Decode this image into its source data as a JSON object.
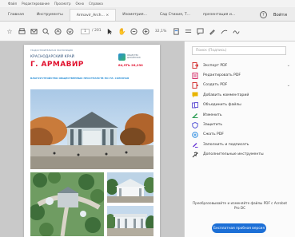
{
  "menubar": {
    "items": [
      "Файл",
      "Редактирование",
      "Просмотр",
      "Окно",
      "Справка"
    ]
  },
  "tabs": {
    "home": "Главная",
    "tools": "Инструменты",
    "docs": [
      {
        "label": "Armavir_Arch... ×"
      },
      {
        "label": "Изометрия..."
      },
      {
        "label": "Сад Стихия, Т..."
      },
      {
        "label": "презентация и..."
      }
    ],
    "help": "?",
    "signin": "Войти"
  },
  "toolbar": {
    "page_current": "1",
    "page_total": "/ 201",
    "zoom": "32,1%"
  },
  "document": {
    "kicker": "ГРАДОСТРОИТЕЛЬНАЯ ЭКСПОЗИЦИЯ",
    "region": "КРАСНОДАРСКИЙ КРАЙ",
    "city": "Г. АРМАВИР",
    "cost": "84,9ТЬ 28,230",
    "logo_text": "ОБЩЕСТВО ДИЗАЙНЕРОВ",
    "subtitle": "БЛАГОУСТРОЙСТВО ОБЩЕСТВЕННЫХ ПРОСТРАНСТВ ПО УЛ. СОЮЗНАЯ"
  },
  "rightpane": {
    "search_placeholder": "Поиск (Подпись)",
    "tools": [
      {
        "label": "Экспорт PDF",
        "icon": "export-pdf-icon",
        "color": "#d63a3a",
        "chevron": true
      },
      {
        "label": "Редактировать PDF",
        "icon": "edit-pdf-icon",
        "color": "#d6336c",
        "chevron": false
      },
      {
        "label": "Создать PDF",
        "icon": "create-pdf-icon",
        "color": "#d63a3a",
        "chevron": true
      },
      {
        "label": "Добавить комментарий",
        "icon": "comment-icon",
        "color": "#e8b400",
        "chevron": false
      },
      {
        "label": "Объединить файлы",
        "icon": "combine-files-icon",
        "color": "#6a5ad6",
        "chevron": false
      },
      {
        "label": "Изменить",
        "icon": "organize-icon",
        "color": "#2e9e56",
        "chevron": false
      },
      {
        "label": "Защитить",
        "icon": "protect-icon",
        "color": "#5a5ad6",
        "chevron": false
      },
      {
        "label": "Сжать PDF",
        "icon": "compress-pdf-icon",
        "color": "#2b8be0",
        "chevron": false
      },
      {
        "label": "Заполнить и подписать",
        "icon": "fill-sign-icon",
        "color": "#6a3ad6",
        "chevron": false
      },
      {
        "label": "Дополнительные инструменты",
        "icon": "more-tools-icon",
        "color": "#333333",
        "chevron": false
      }
    ],
    "promo_text": "Преобразовывайте и изменяйте файлы PDF с Acrobat Pro DC",
    "promo_button": "Бесплатная пробная версия"
  }
}
